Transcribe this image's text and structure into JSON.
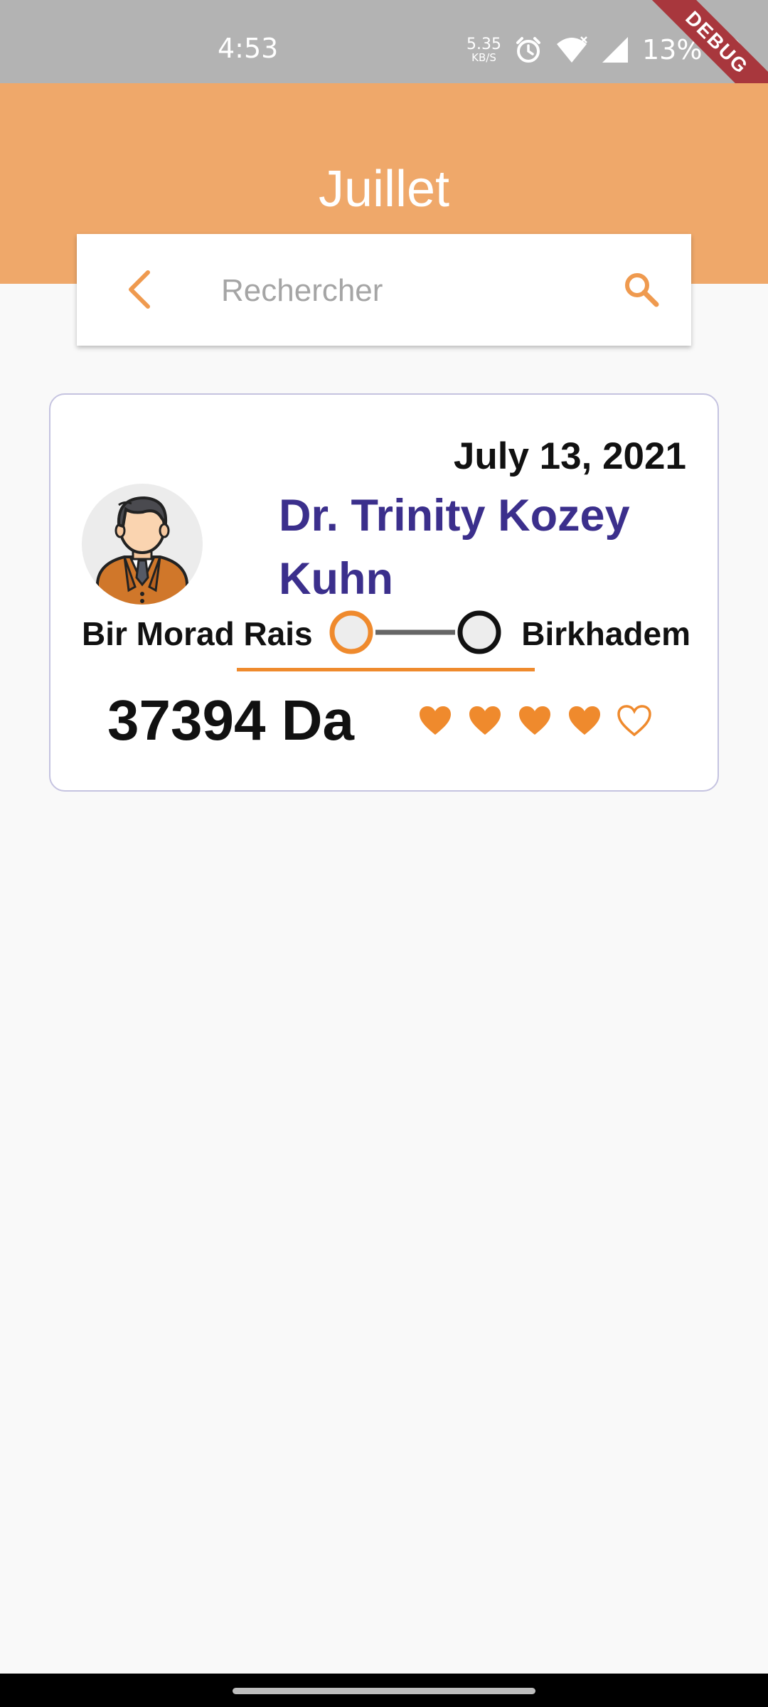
{
  "status_bar": {
    "time": "4:53",
    "net_speed_value": "5.35",
    "net_speed_unit": "KB/S",
    "battery": "13%",
    "debug_label": "DEBUG",
    "icons": [
      "alarm-icon",
      "wifi-icon",
      "signal-icon",
      "battery-saver-icon"
    ]
  },
  "header": {
    "title": "Juillet",
    "background_color": "#efa86a"
  },
  "search": {
    "placeholder": "Rechercher",
    "value": "",
    "back_icon": "chevron-left-icon",
    "search_icon": "search-icon",
    "icon_color": "#ef9a4f"
  },
  "trips": [
    {
      "date": "July 13, 2021",
      "driver_name": "Dr. Trinity Kozey Kuhn",
      "from": "Bir Morad Rais",
      "to": "Birkhadem",
      "price": "37394 Da",
      "rating": 4,
      "rating_max": 5
    }
  ],
  "colors": {
    "accent": "#ef8a2d",
    "name": "#3b2f8c",
    "card_border": "#c5c3e0"
  }
}
